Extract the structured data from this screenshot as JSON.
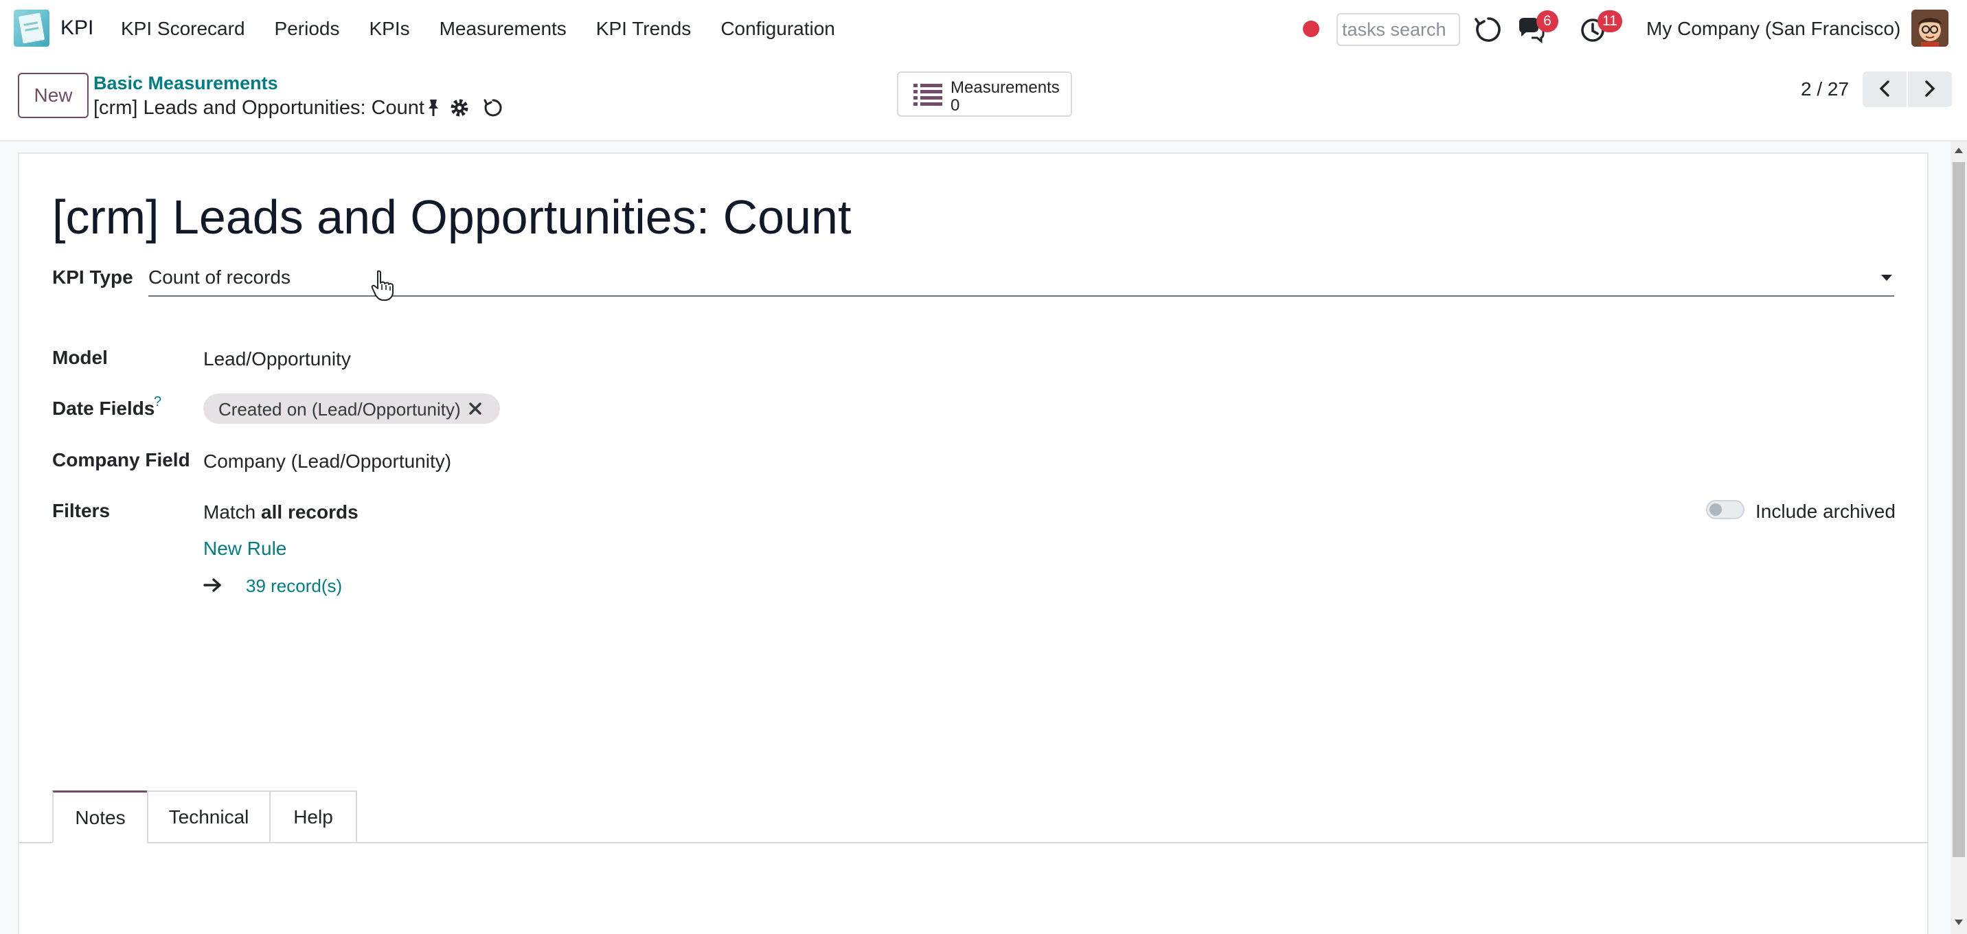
{
  "navbar": {
    "app_name": "KPI",
    "menu": [
      "KPI Scorecard",
      "Periods",
      "KPIs",
      "Measurements",
      "KPI Trends",
      "Configuration"
    ],
    "search_placeholder": "tasks search",
    "messages_badge": "6",
    "activities_badge": "11",
    "company": "My Company (San Francisco)"
  },
  "control": {
    "new_label": "New",
    "breadcrumb_parent": "Basic Measurements",
    "breadcrumb_current": "[crm] Leads and Opportunities: Count",
    "smart_button": {
      "label": "Measurements",
      "value": "0"
    },
    "pager": "2 / 27"
  },
  "form": {
    "title": "[crm] Leads and Opportunities: Count",
    "kpi_type": {
      "label": "KPI Type",
      "value": "Count of records"
    },
    "model": {
      "label": "Model",
      "value": "Lead/Opportunity"
    },
    "date_fields": {
      "label": "Date Fields",
      "help": "?",
      "tags": [
        "Created on (Lead/Opportunity)"
      ]
    },
    "company_field": {
      "label": "Company Field",
      "value": "Company (Lead/Opportunity)"
    },
    "filters": {
      "label": "Filters",
      "match_prefix": "Match",
      "match_value": "all records",
      "include_archived": "Include archived",
      "new_rule": "New Rule",
      "records": "39 record(s)"
    }
  },
  "tabs": [
    "Notes",
    "Technical",
    "Help"
  ],
  "colors": {
    "primary": "#714b67",
    "link": "#017e84",
    "badge": "#dc3545"
  }
}
